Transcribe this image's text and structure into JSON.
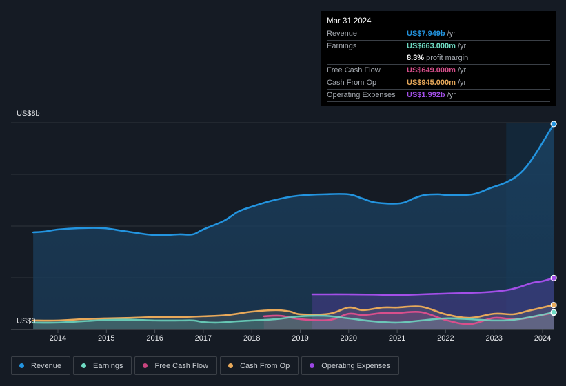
{
  "tooltip": {
    "date": "Mar 31 2024",
    "rows": [
      {
        "label": "Revenue",
        "value": "US$7.949b",
        "unit": "/yr",
        "color": "#2394df"
      },
      {
        "label": "Earnings",
        "value": "US$663.000m",
        "unit": "/yr",
        "color": "#6fdbc3"
      },
      {
        "label": "",
        "margin_value": "8.3%",
        "margin_text": "profit margin"
      },
      {
        "label": "Free Cash Flow",
        "value": "US$649.000m",
        "unit": "/yr",
        "color": "#d94f8c"
      },
      {
        "label": "Cash From Op",
        "value": "US$945.000m",
        "unit": "/yr",
        "color": "#e8a95a"
      },
      {
        "label": "Operating Expenses",
        "value": "US$1.992b",
        "unit": "/yr",
        "color": "#a34fe8"
      }
    ]
  },
  "legend": [
    {
      "label": "Revenue",
      "color": "#2394df"
    },
    {
      "label": "Earnings",
      "color": "#6fdbc3"
    },
    {
      "label": "Free Cash Flow",
      "color": "#c9457f"
    },
    {
      "label": "Cash From Op",
      "color": "#e8a95a"
    },
    {
      "label": "Operating Expenses",
      "color": "#9b47e4"
    }
  ],
  "chart_data": {
    "type": "area",
    "title": "",
    "xlabel": "",
    "ylabel": "",
    "y_tick_labels": [
      "US$0",
      "US$8b"
    ],
    "ylim": [
      0,
      8
    ],
    "y_unit": "US$ billions",
    "xlim": [
      2013.49,
      2024.25
    ],
    "x_ticks": [
      2014,
      2015,
      2016,
      2017,
      2018,
      2019,
      2020,
      2021,
      2022,
      2023,
      2024
    ],
    "x_tick_labels": [
      "2014",
      "2015",
      "2016",
      "2017",
      "2018",
      "2019",
      "2020",
      "2021",
      "2022",
      "2023",
      "2024"
    ],
    "grid": true,
    "legend_position": "bottom",
    "highlight_start": 2023.25,
    "series": [
      {
        "name": "Revenue",
        "color": "#2394df",
        "x": [
          2013.49,
          2013.73,
          2014.01,
          2014.44,
          2014.94,
          2015.36,
          2016.0,
          2016.5,
          2016.78,
          2017.0,
          2017.43,
          2017.72,
          2018.0,
          2018.43,
          2018.93,
          2019.5,
          2019.99,
          2020.28,
          2020.56,
          2021.06,
          2021.34,
          2021.56,
          2021.84,
          2022.06,
          2022.56,
          2022.92,
          2023.27,
          2023.56,
          2023.84,
          2024.23
        ],
        "values": [
          3.76,
          3.79,
          3.87,
          3.92,
          3.92,
          3.81,
          3.65,
          3.68,
          3.68,
          3.87,
          4.21,
          4.56,
          4.75,
          4.99,
          5.17,
          5.23,
          5.23,
          5.07,
          4.91,
          4.88,
          5.07,
          5.2,
          5.23,
          5.2,
          5.23,
          5.47,
          5.71,
          6.08,
          6.75,
          7.949
        ]
      },
      {
        "name": "Earnings",
        "color": "#6fdbc3",
        "x": [
          2013.49,
          2014.0,
          2014.5,
          2015.0,
          2015.5,
          2016.0,
          2016.5,
          2016.8,
          2017.0,
          2017.3,
          2017.7,
          2018.0,
          2018.5,
          2019.0,
          2019.5,
          2020.0,
          2020.5,
          2021.0,
          2021.5,
          2022.0,
          2022.5,
          2023.0,
          2023.5,
          2024.23
        ],
        "values": [
          0.27,
          0.27,
          0.32,
          0.37,
          0.38,
          0.35,
          0.35,
          0.35,
          0.29,
          0.27,
          0.32,
          0.35,
          0.4,
          0.51,
          0.53,
          0.43,
          0.32,
          0.27,
          0.35,
          0.43,
          0.4,
          0.35,
          0.4,
          0.663
        ]
      },
      {
        "name": "Free Cash Flow",
        "color": "#d94f8c",
        "x": [
          2018.25,
          2018.6,
          2019.0,
          2019.6,
          2020.0,
          2020.3,
          2020.7,
          2021.0,
          2021.5,
          2022.0,
          2022.5,
          2023.0,
          2023.5,
          2024.23
        ],
        "values": [
          0.51,
          0.53,
          0.4,
          0.37,
          0.61,
          0.56,
          0.64,
          0.64,
          0.67,
          0.37,
          0.21,
          0.45,
          0.4,
          0.649
        ]
      },
      {
        "name": "Cash From Op",
        "color": "#e8a95a",
        "x": [
          2013.49,
          2014.0,
          2014.5,
          2015.0,
          2015.5,
          2016.0,
          2016.5,
          2017.0,
          2017.5,
          2018.0,
          2018.5,
          2018.8,
          2019.0,
          2019.6,
          2020.0,
          2020.3,
          2020.7,
          2021.0,
          2021.5,
          2022.0,
          2022.5,
          2023.0,
          2023.4,
          2023.7,
          2024.23
        ],
        "values": [
          0.35,
          0.35,
          0.4,
          0.43,
          0.45,
          0.48,
          0.48,
          0.51,
          0.56,
          0.69,
          0.75,
          0.69,
          0.59,
          0.61,
          0.85,
          0.75,
          0.85,
          0.85,
          0.88,
          0.59,
          0.45,
          0.61,
          0.59,
          0.72,
          0.945
        ]
      },
      {
        "name": "Operating Expenses",
        "color": "#a34fe8",
        "x": [
          2019.25,
          2019.6,
          2020.0,
          2020.5,
          2021.0,
          2021.5,
          2022.0,
          2022.8,
          2023.25,
          2023.5,
          2023.8,
          2024.0,
          2024.23
        ],
        "values": [
          1.36,
          1.36,
          1.36,
          1.35,
          1.33,
          1.36,
          1.39,
          1.44,
          1.52,
          1.63,
          1.81,
          1.87,
          1.992
        ]
      }
    ]
  }
}
